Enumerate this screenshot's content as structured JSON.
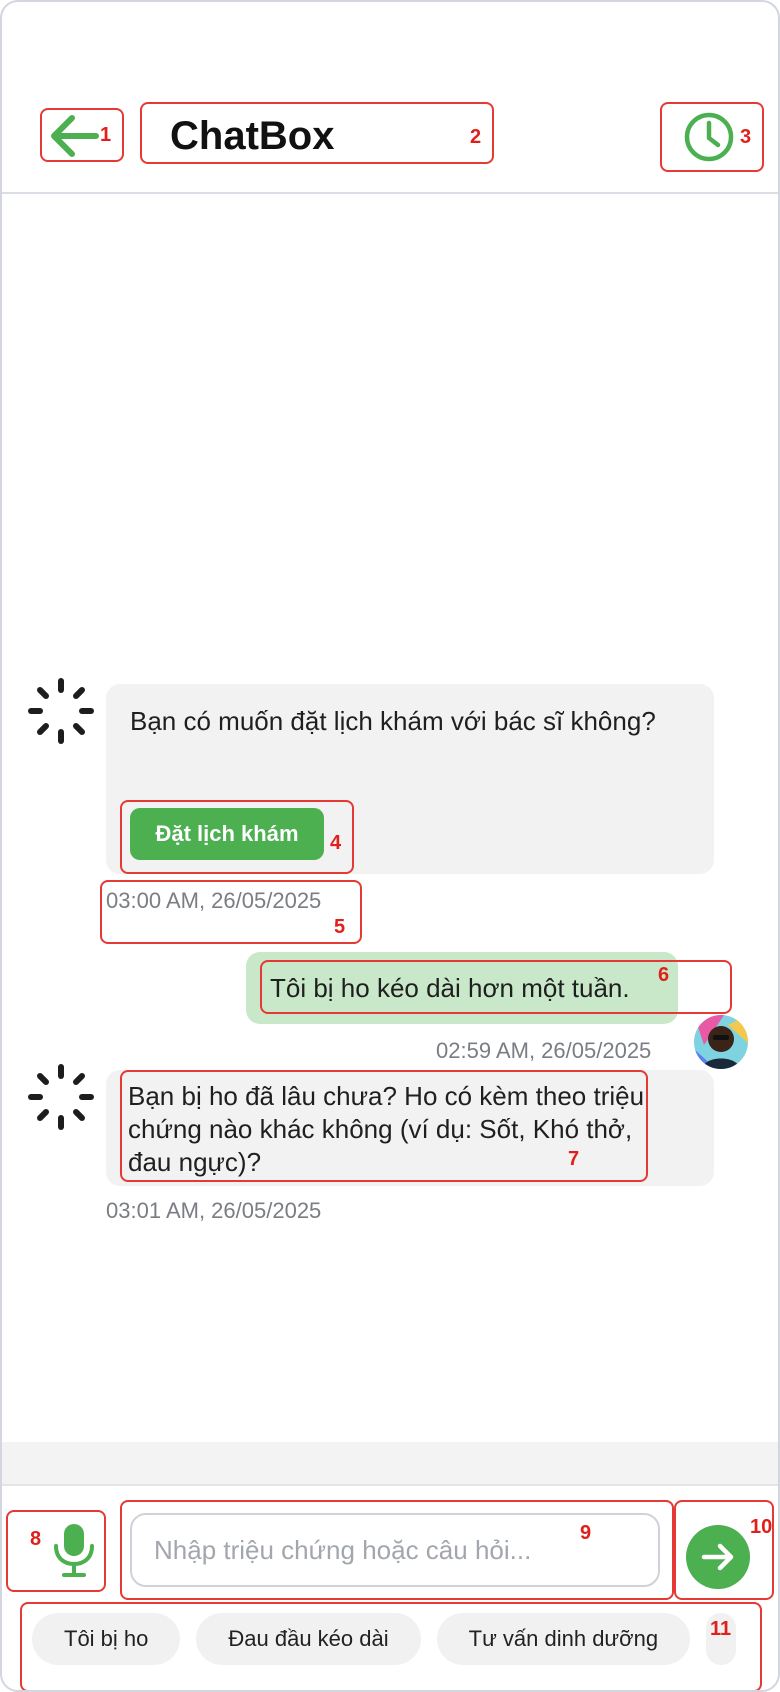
{
  "header": {
    "title": "ChatBox",
    "back_icon": "arrow-left-icon",
    "history_icon": "clock-icon"
  },
  "messages": [
    {
      "sender": "bot",
      "text": "Bạn có muốn đặt lịch khám với bác sĩ không?",
      "action_label": "Đặt lịch khám",
      "time": "03:00 AM, 26/05/2025"
    },
    {
      "sender": "user",
      "text": "Tôi bị ho kéo dài hơn một tuần.",
      "time": "02:59 AM, 26/05/2025"
    },
    {
      "sender": "bot",
      "text": "Bạn bị ho đã lâu chưa? Ho có kèm theo triệu chứng nào khác không (ví dụ: Sốt, Khó thở, đau ngực)?",
      "time": "03:01 AM, 26/05/2025"
    }
  ],
  "composer": {
    "mic_icon": "microphone-icon",
    "placeholder": "Nhập triệu chứng hoặc câu hỏi...",
    "value": "",
    "send_icon": "arrow-right-icon"
  },
  "quick_replies": [
    "Tôi bị ho",
    "Đau đầu kéo dài",
    "Tư vấn dinh dưỡng"
  ],
  "annotations": [
    "1",
    "2",
    "3",
    "4",
    "5",
    "6",
    "7",
    "8",
    "9",
    "10",
    "11"
  ],
  "colors": {
    "accent": "#4caf50",
    "user_bubble": "#c8e8c9",
    "bot_bubble": "#f2f2f3",
    "annotation": "#e53935"
  }
}
